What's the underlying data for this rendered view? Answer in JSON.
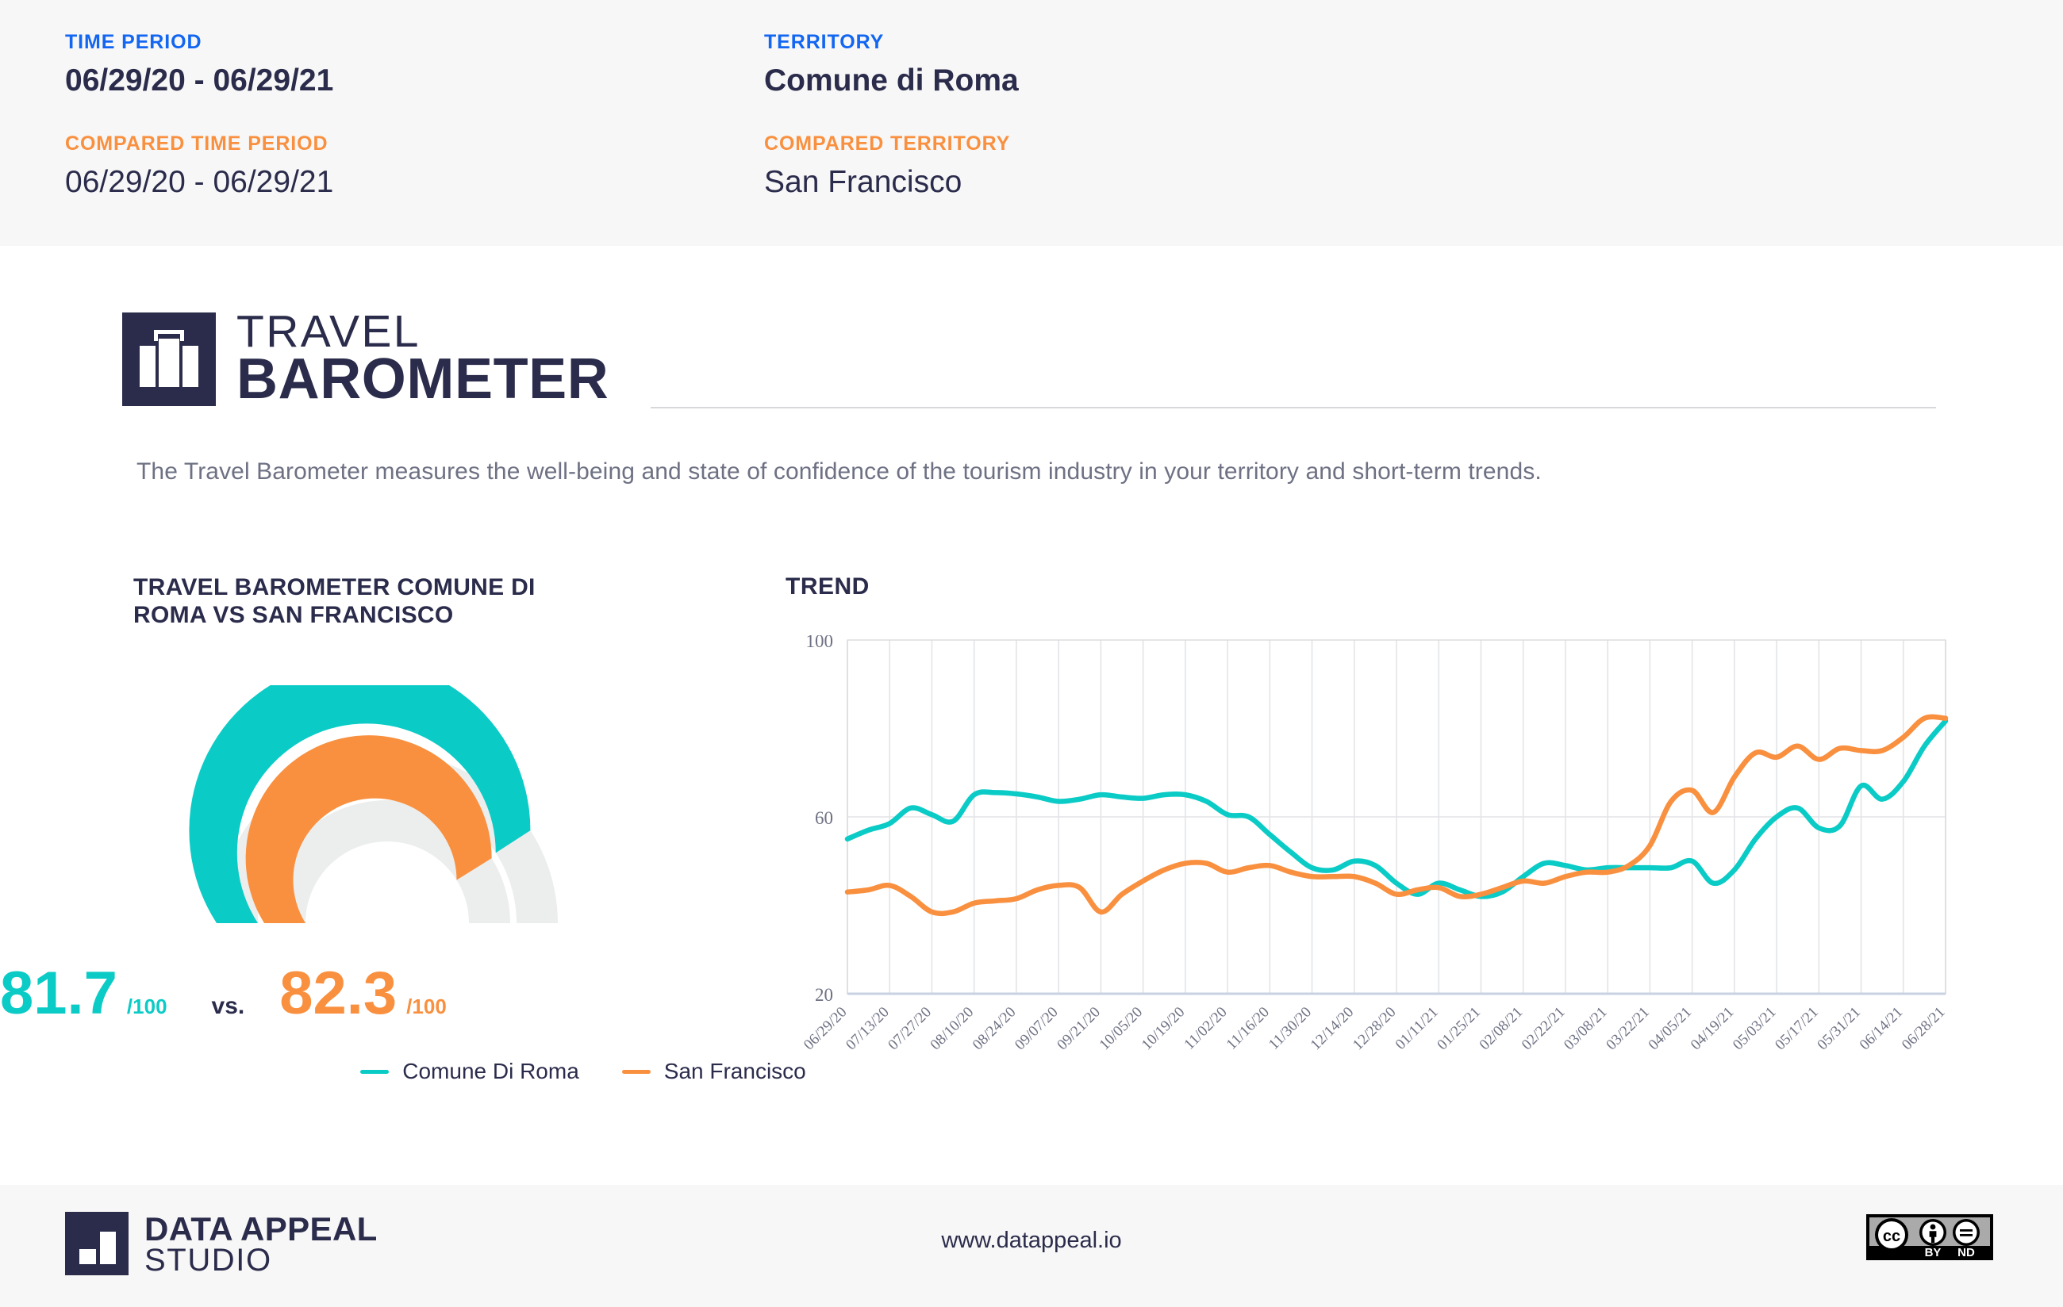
{
  "header": {
    "time_period_label": "TIME PERIOD",
    "time_period_value": "06/29/20 - 06/29/21",
    "territory_label": "TERRITORY",
    "territory_value": "Comune di Roma",
    "compared_time_period_label": "COMPARED TIME PERIOD",
    "compared_time_period_value": "06/29/20 - 06/29/21",
    "compared_territory_label": "COMPARED TERRITORY",
    "compared_territory_value": "San Francisco"
  },
  "brand": {
    "line1": "TRAVEL",
    "line2": "BAROMETER",
    "icon": "suitcase-icon"
  },
  "description": "The Travel Barometer measures the well-being and state of confidence of the tourism industry in your territory and short-term trends.",
  "gauge": {
    "title": "TRAVEL BAROMETER COMUNE DI ROMA VS SAN FRANCISCO",
    "primary_value": "81.7",
    "primary_denominator": "/100",
    "vs_label": "vs.",
    "compare_value": "82.3",
    "compare_denominator": "/100",
    "primary_pct": 81.7,
    "compare_pct": 82.3,
    "max": 100,
    "primary_color": "#0bcbc6",
    "compare_color": "#f9903f",
    "track_color": "#eceded"
  },
  "chart_data": {
    "type": "line",
    "title": "TREND",
    "xlabel": "",
    "ylabel": "",
    "ylim": [
      20,
      100
    ],
    "yticks": [
      20,
      60,
      100
    ],
    "grid": true,
    "legend_position": "bottom",
    "categories": [
      "06/29/20",
      "07/13/20",
      "07/27/20",
      "08/10/20",
      "08/24/20",
      "09/07/20",
      "09/21/20",
      "10/05/20",
      "10/19/20",
      "11/02/20",
      "11/16/20",
      "11/30/20",
      "12/14/20",
      "12/28/20",
      "01/11/21",
      "01/25/21",
      "02/08/21",
      "02/22/21",
      "03/08/21",
      "03/22/21",
      "04/05/21",
      "04/19/21",
      "05/03/21",
      "05/17/21",
      "05/31/21",
      "06/14/21",
      "06/28/21"
    ],
    "x_all": [
      "06/29/20",
      "07/06/20",
      "07/13/20",
      "07/20/20",
      "07/27/20",
      "08/03/20",
      "08/10/20",
      "08/17/20",
      "08/24/20",
      "08/31/20",
      "09/07/20",
      "09/14/20",
      "09/21/20",
      "09/28/20",
      "10/05/20",
      "10/12/20",
      "10/19/20",
      "10/26/20",
      "11/02/20",
      "11/09/20",
      "11/16/20",
      "11/23/20",
      "11/30/20",
      "12/07/20",
      "12/14/20",
      "12/21/20",
      "12/28/20",
      "01/04/21",
      "01/11/21",
      "01/18/21",
      "01/25/21",
      "02/01/21",
      "02/08/21",
      "02/15/21",
      "02/22/21",
      "03/01/21",
      "03/08/21",
      "03/15/21",
      "03/22/21",
      "03/29/21",
      "04/05/21",
      "04/12/21",
      "04/19/21",
      "04/26/21",
      "05/03/21",
      "05/10/21",
      "05/17/21",
      "05/24/21",
      "05/31/21",
      "06/07/21",
      "06/14/21",
      "06/21/21",
      "06/28/21"
    ],
    "series": [
      {
        "name": "Comune Di Roma",
        "color": "#0bcbc6",
        "values": [
          55.0,
          57.0,
          58.5,
          62.0,
          60.5,
          59.0,
          65.0,
          65.5,
          65.2,
          64.5,
          63.5,
          64.0,
          65.0,
          64.5,
          64.2,
          65.0,
          65.0,
          63.5,
          60.5,
          60.0,
          56.0,
          52.0,
          48.5,
          48.0,
          50.0,
          49.0,
          45.0,
          42.5,
          45.0,
          43.5,
          42.0,
          43.0,
          46.5,
          49.5,
          49.0,
          48.0,
          48.5,
          48.5,
          48.5,
          48.5,
          50.0,
          45.0,
          48.0,
          55.0,
          60.0,
          62.0,
          57.5,
          58.0,
          67.0,
          64.0,
          68.0,
          76.0,
          81.7
        ]
      },
      {
        "name": "San Francisco",
        "color": "#f9903f",
        "values": [
          43.0,
          43.5,
          44.5,
          42.0,
          38.5,
          38.5,
          40.5,
          41.0,
          41.5,
          43.5,
          44.5,
          44.0,
          38.5,
          42.5,
          45.5,
          48.0,
          49.5,
          49.5,
          47.5,
          48.5,
          49.0,
          47.5,
          46.5,
          46.5,
          46.5,
          45.0,
          42.5,
          43.5,
          44.0,
          42.0,
          42.5,
          44.0,
          45.5,
          45.0,
          46.5,
          47.5,
          47.5,
          49.0,
          53.5,
          63.5,
          66.0,
          61.0,
          69.0,
          74.5,
          73.5,
          76.0,
          73.0,
          75.5,
          75.0,
          75.0,
          78.0,
          82.3,
          82.3
        ]
      }
    ]
  },
  "legend": [
    {
      "label": "Comune Di Roma",
      "color": "#0bcbc6"
    },
    {
      "label": "San Francisco",
      "color": "#f9903f"
    }
  ],
  "footer": {
    "brand_line1": "DATA APPEAL",
    "brand_line2": "STUDIO",
    "url": "www.datappeal.io",
    "license": "CC BY ND",
    "license_cc": "cc",
    "license_by": "BY",
    "license_nd": "ND"
  }
}
